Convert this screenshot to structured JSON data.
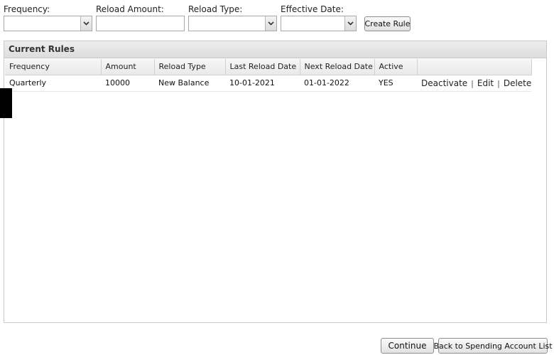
{
  "form": {
    "frequency_label": "Frequency:",
    "frequency_value": "",
    "reload_amount_label": "Reload Amount:",
    "reload_amount_value": "",
    "reload_type_label": "Reload Type:",
    "reload_type_value": "",
    "effective_date_label": "Effective Date:",
    "effective_date_value": "",
    "create_rule_label": "Create Rule",
    "dropdown_icon": "chevron-down-icon"
  },
  "rules_panel": {
    "title": "Current Rules",
    "columns": [
      "Frequency",
      "Amount",
      "Reload Type",
      "Last Reload Date",
      "Next Reload Date",
      "Active",
      ""
    ],
    "rows": [
      {
        "frequency": "Quarterly",
        "amount": "10000",
        "reload_type": "New Balance",
        "last_reload_date": "10-01-2021",
        "next_reload_date": "01-01-2022",
        "active": "YES",
        "actions": {
          "deactivate": "Deactivate",
          "separator": "|",
          "edit": "Edit",
          "delete": "Delete"
        }
      }
    ]
  },
  "footer": {
    "continue_label": "Continue",
    "back_label": "Back to Spending Account List"
  }
}
